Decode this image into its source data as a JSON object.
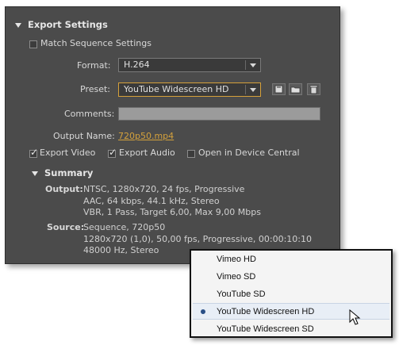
{
  "export_settings": {
    "title": "Export Settings",
    "match_sequence_label": "Match Sequence Settings",
    "match_sequence_checked": false,
    "format_label": "Format:",
    "format_value": "H.264",
    "preset_label": "Preset:",
    "preset_value": "YouTube Widescreen HD",
    "comments_label": "Comments:",
    "comments_value": "",
    "output_name_label": "Output Name:",
    "output_name_value": "720p50.mp4",
    "export_video_label": "Export Video",
    "export_video_checked": true,
    "export_audio_label": "Export Audio",
    "export_audio_checked": true,
    "device_central_label": "Open in Device Central",
    "device_central_checked": false,
    "preset_icons": [
      "save-preset-icon",
      "import-preset-icon",
      "delete-preset-icon"
    ]
  },
  "summary": {
    "title": "Summary",
    "output_label": "Output:",
    "output_lines": [
      "NTSC, 1280x720, 24 fps, Progressive",
      "AAC, 64 kbps, 44.1 kHz, Stereo",
      "VBR, 1 Pass, Target 6,00, Max 9,00 Mbps"
    ],
    "source_label": "Source:",
    "source_lines": [
      "Sequence, 720p50",
      "1280x720 (1,0), 50,00 fps, Progressive, 00:00:10:10",
      "48000 Hz, Stereo"
    ]
  },
  "preset_menu": {
    "items": [
      {
        "label": "Vimeo HD",
        "selected": false
      },
      {
        "label": "Vimeo SD",
        "selected": false
      },
      {
        "label": "YouTube SD",
        "selected": false
      },
      {
        "label": "YouTube Widescreen HD",
        "selected": true
      },
      {
        "label": "YouTube Widescreen SD",
        "selected": false
      }
    ]
  },
  "colors": {
    "panel_bg": "#4b4b4b",
    "accent_link": "#d4a13c",
    "focus_border": "#d6a13a",
    "menu_bg": "#f4f4f4"
  }
}
